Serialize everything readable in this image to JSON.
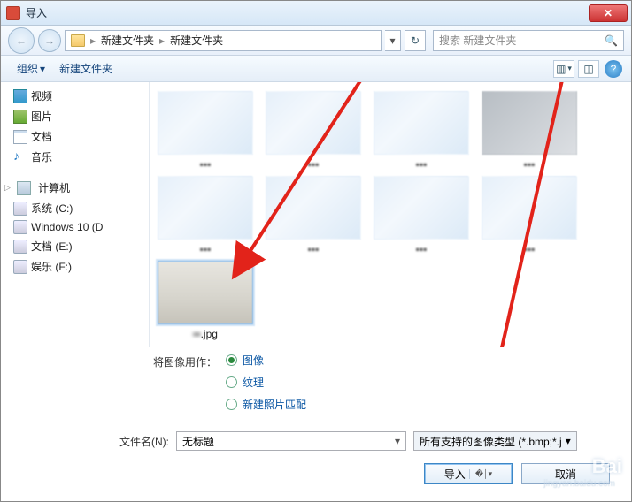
{
  "window": {
    "title": "导入"
  },
  "breadcrumb": {
    "seg1": "新建文件夹",
    "seg2": "新建文件夹"
  },
  "search": {
    "placeholder": "搜索 新建文件夹"
  },
  "toolbar": {
    "organize": "组织",
    "newfolder": "新建文件夹"
  },
  "sidebar": {
    "libs": [
      {
        "label": "视频",
        "ico": "ico-video"
      },
      {
        "label": "图片",
        "ico": "ico-image"
      },
      {
        "label": "文档",
        "ico": "ico-doc"
      },
      {
        "label": "音乐",
        "ico": "ico-music"
      }
    ],
    "computer": "计算机",
    "drives": [
      {
        "label": "系统 (C:)"
      },
      {
        "label": "Windows 10 (D"
      },
      {
        "label": "文档 (E:)"
      },
      {
        "label": "娱乐 (F:)"
      }
    ]
  },
  "files": {
    "selected_label": ".jpg"
  },
  "options": {
    "label": "将图像用作：",
    "r1": "图像",
    "r2": "纹理",
    "r3": "新建照片匹配"
  },
  "filename": {
    "label": "文件名(N):",
    "value": "无标题",
    "typefilter": "所有支持的图像类型 (*.bmp;*.j"
  },
  "buttons": {
    "import": "导入",
    "cancel": "取消"
  },
  "watermark": {
    "brand": "Bai",
    "url": "jingyan.baidu.com"
  }
}
